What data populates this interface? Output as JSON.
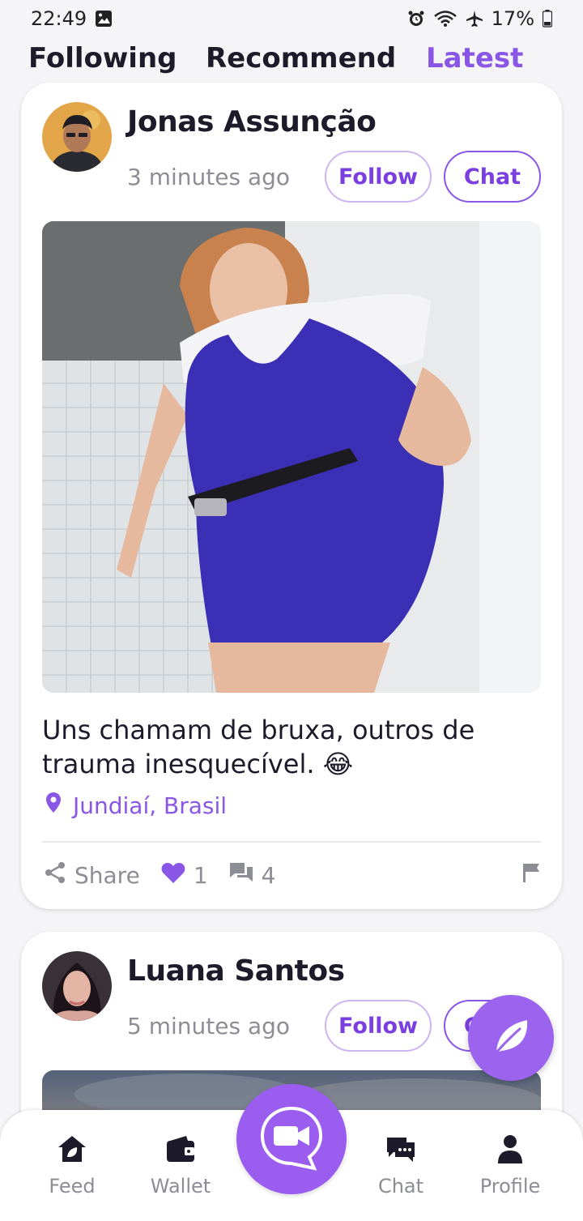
{
  "status_bar": {
    "time": "22:49",
    "battery": "17%"
  },
  "top_tabs": {
    "following": "Following",
    "recommend": "Recommend",
    "latest": "Latest",
    "active": "latest"
  },
  "posts": [
    {
      "author": "Jonas Assunção",
      "time_ago": "3 minutes ago",
      "follow_label": "Follow",
      "chat_label": "Chat",
      "caption": "Uns chamam de bruxa, outros de trauma inesquecível. 😂",
      "location": "Jundiaí, Brasil",
      "share_label": "Share",
      "likes": "1",
      "comments": "4"
    },
    {
      "author": "Luana Santos",
      "time_ago": "5 minutes ago",
      "follow_label": "Follow",
      "chat_label": "Chat"
    }
  ],
  "bottom_nav": {
    "feed": "Feed",
    "wallet": "Wallet",
    "chat": "Chat",
    "profile": "Profile"
  },
  "colors": {
    "accent": "#8a56e6",
    "muted": "#8d8d96",
    "text": "#1d1b2a"
  },
  "icons": [
    "image-icon",
    "alarm-icon",
    "wifi-icon",
    "airplane-icon",
    "battery-icon",
    "location-pin-icon",
    "share-icon",
    "heart-icon",
    "comment-icon",
    "flag-icon",
    "leaf-icon",
    "video-call-icon",
    "feed-home-icon",
    "wallet-icon",
    "chat-bubbles-icon",
    "profile-icon"
  ]
}
